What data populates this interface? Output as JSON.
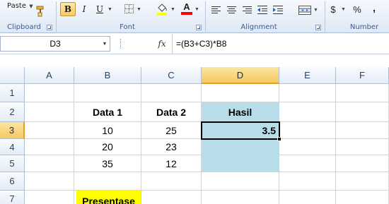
{
  "ribbon": {
    "clipboard": {
      "paste_label": "Paste",
      "group_label": "Clipboard"
    },
    "font": {
      "bold": "B",
      "italic": "I",
      "underline": "U",
      "font_color_letter": "A",
      "group_label": "Font"
    },
    "alignment": {
      "group_label": "Alignment"
    },
    "number": {
      "currency": "$",
      "percent": "%",
      "comma": ",",
      "group_label": "Number"
    },
    "colors": {
      "fill_bucket": "#ffff00",
      "font_color": "#ff0000",
      "accent": "#3b5b8a"
    }
  },
  "formula_bar": {
    "name_box": "D3",
    "fx_label": "fx",
    "formula": "=(B3+C3)*B8"
  },
  "grid": {
    "columns": [
      "A",
      "B",
      "C",
      "D",
      "E",
      "F"
    ],
    "rows": [
      "1",
      "2",
      "3",
      "4",
      "5",
      "6",
      "7"
    ],
    "active_cell": "D3",
    "headers": {
      "b2": "Data 1",
      "c2": "Data 2",
      "d2": "Hasil"
    },
    "data": [
      {
        "b": "10",
        "c": "25",
        "d": "3.5"
      },
      {
        "b": "20",
        "c": "23",
        "d": ""
      },
      {
        "b": "35",
        "c": "12",
        "d": ""
      }
    ],
    "b7": "Presentase",
    "highlight_colors": {
      "hasil": "#b7dde8",
      "presentase": "#ffff00"
    }
  }
}
